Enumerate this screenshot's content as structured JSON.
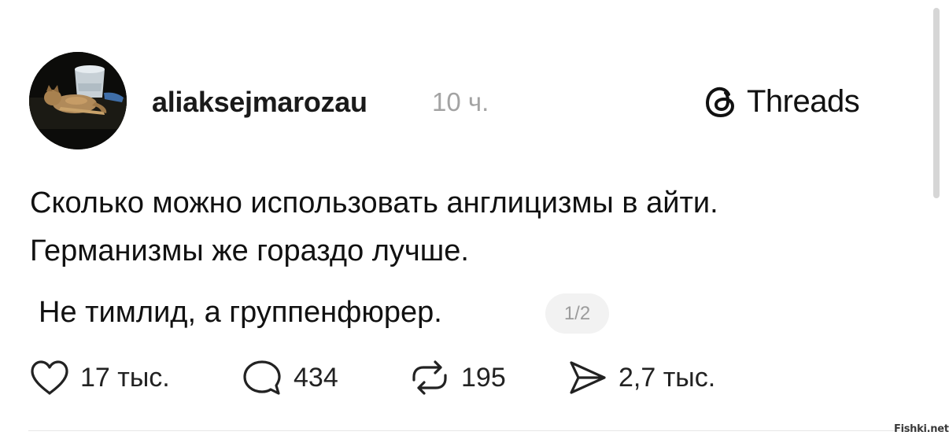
{
  "post": {
    "author": "aliaksejmarozau",
    "time": "10 ч.",
    "brand": "Threads",
    "text_lines": [
      "Сколько можно использовать англицизмы в айти.",
      "Германизмы же гораздо лучше."
    ],
    "text_line_3": "Не тимлид, а группенфюрер.",
    "page_indicator": "1/2"
  },
  "actions": {
    "likes": "17 тыс.",
    "replies": "434",
    "reposts": "195",
    "shares": "2,7 тыс."
  },
  "icons": {
    "avatar": "avatar-photo",
    "brand": "threads-logo-icon",
    "like": "heart-icon",
    "reply": "speech-bubble-icon",
    "repost": "repost-icon",
    "share": "paper-plane-icon"
  },
  "watermark": "Fishki.net"
}
